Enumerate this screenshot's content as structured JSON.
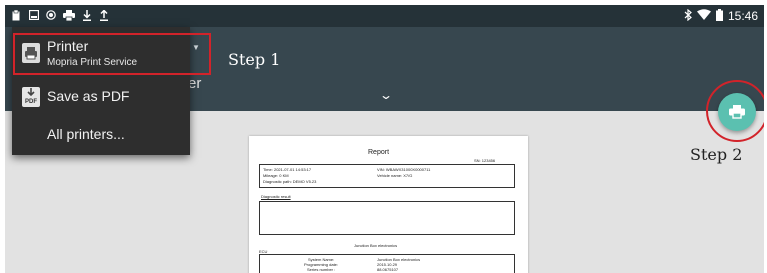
{
  "status_bar": {
    "left_icons": [
      "clipboard-icon",
      "image-icon",
      "record-icon",
      "printer-icon",
      "download-icon",
      "upload-icon"
    ],
    "right_icons": [
      "bluetooth-icon",
      "wifi-icon",
      "battery-icon"
    ],
    "time": "15:46"
  },
  "printer_menu": {
    "items": [
      {
        "label": "Printer",
        "sublabel": "Mopria Print Service",
        "icon": "printer-icon"
      },
      {
        "label": "Save as PDF",
        "icon": "pdf-icon"
      },
      {
        "label": "All printers..."
      }
    ],
    "pdf_icon_text": "PDF",
    "partial_text": "er"
  },
  "annotations": {
    "step1": "Step 1",
    "step2": "Step 2",
    "highlight_color": "#d2232a"
  },
  "fab": {
    "icon": "printer-icon",
    "color": "#5bc0b0"
  },
  "report": {
    "title": "Report",
    "sn": "SN: 123456",
    "time": "Time: 2021-07-01 14:53:17",
    "mileage": "Mileage: 0 KM",
    "diagnostic_path": "Diagnostic path: DEMO V5.23",
    "vin": "VIN: WBAWX31000X0000711",
    "vehicle_name": "Vehicle name: X7/G",
    "diagnostic_result": "Diagnostic result",
    "section": "Junction Box electronics",
    "ecu": "ECU",
    "system_name_label": "System Name:",
    "system_name_value": "Junction Box electronics",
    "programming_date_label": "Programming date:",
    "programming_date_value": "2015.10.29",
    "series_number_label": "Series number :",
    "series_number_value": "88.0675107"
  }
}
